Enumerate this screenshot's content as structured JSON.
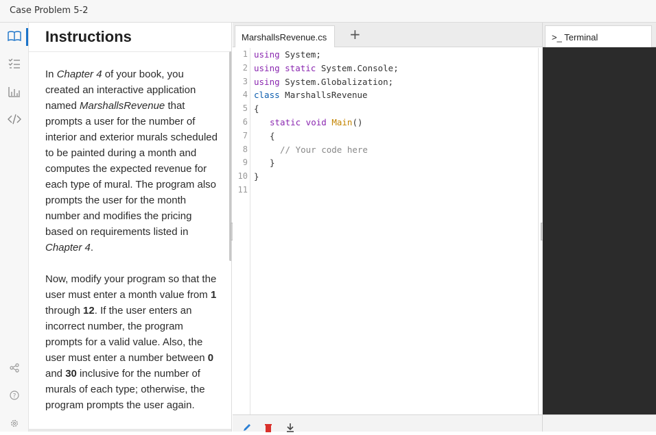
{
  "window": {
    "title": "Case Problem 5-2"
  },
  "rail": {
    "icons": [
      "book-icon",
      "list-icon",
      "chart-icon",
      "code-icon",
      "share-icon",
      "help-icon",
      "settings-icon"
    ]
  },
  "instructions": {
    "heading": "Instructions",
    "p1": {
      "a": "In ",
      "b": "Chapter 4",
      "c": " of your book, you created an interactive application named ",
      "d": "MarshallsRevenue",
      "e": " that prompts a user for the number of interior and exterior murals scheduled to be painted during a month and computes the expected revenue for each type of mural. The program also prompts the user for the month number and modifies the pricing based on requirements listed in ",
      "f": "Chapter 4",
      "g": "."
    },
    "p2": {
      "a": "Now, modify your program so that the user must enter a month value from ",
      "b": "1",
      "c": " through ",
      "d": "12",
      "e": ". If the user enters an incorrect number, the program prompts for a valid value. Also, the user must enter a number between ",
      "f": "0",
      "g": " and ",
      "h": "30",
      "i": " inclusive for the number of murals of each type; otherwise, the program prompts the user again."
    }
  },
  "editor": {
    "tab_label": "MarshallsRevenue.cs",
    "add_tab": "+",
    "line_numbers": [
      "1",
      "2",
      "3",
      "4",
      "5",
      "6",
      "7",
      "8",
      "9",
      "10",
      "11"
    ],
    "code": {
      "l1_kw": "using",
      "l1_rest": " System;",
      "l2_kw": "using static",
      "l2_rest": " System.Console;",
      "l3_kw": "using",
      "l3_rest": " System.Globalization;",
      "l4_kw": "class",
      "l4_rest": " MarshallsRevenue",
      "l5": "{",
      "l6_kw": "static void",
      "l6_fn": "Main",
      "l6_rest": "()",
      "l7": "{",
      "l8": "// Your code here",
      "l9": "}",
      "l10": "}"
    }
  },
  "terminal": {
    "tab_label": "Terminal",
    "prompt_glyph": ">_"
  }
}
